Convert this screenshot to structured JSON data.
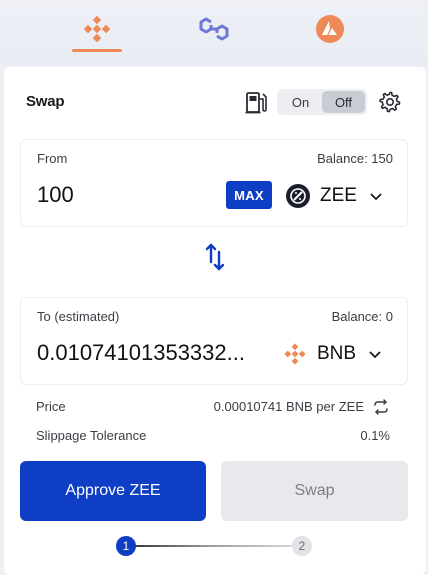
{
  "chain_tabs": [
    {
      "name": "BNB Chain",
      "icon": "bnb-icon",
      "active": true,
      "color": "#ee8a58"
    },
    {
      "name": "Polygon",
      "icon": "polygon-icon",
      "active": false,
      "color": "#6f78d8"
    },
    {
      "name": "Avalanche",
      "icon": "avalanche-icon",
      "active": false,
      "color": "#ee8a58"
    }
  ],
  "header": {
    "title": "Swap",
    "gas_toggle": {
      "on_label": "On",
      "off_label": "Off",
      "selected": "Off"
    }
  },
  "from": {
    "label": "From",
    "balance": "Balance: 150",
    "amount": "100",
    "max_label": "MAX",
    "token": "ZEE"
  },
  "to": {
    "label": "To (estimated)",
    "balance": "Balance: 0",
    "amount": "0.01074101353332...",
    "token": "BNB"
  },
  "info": {
    "price_label": "Price",
    "price_value": "0.00010741 BNB per ZEE",
    "slippage_label": "Slippage Tolerance",
    "slippage_value": "0.1%"
  },
  "actions": {
    "approve_label": "Approve ZEE",
    "swap_label": "Swap"
  },
  "steps": {
    "step1": "1",
    "step2": "2",
    "current": 1
  },
  "colors": {
    "accent": "#0d3ec4",
    "bnb": "#ee8a58",
    "disabled": "#e8e9ec"
  }
}
